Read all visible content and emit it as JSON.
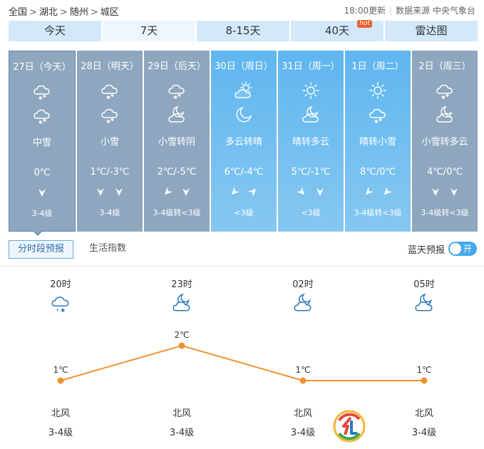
{
  "breadcrumb": [
    "全国",
    "湖北",
    "随州",
    "城区"
  ],
  "update_time": "18:00更新",
  "source_label": "数据来源 中央气象台",
  "tabs": [
    {
      "label": "今天",
      "active": false
    },
    {
      "label": "7天",
      "active": true
    },
    {
      "label": "8-15天",
      "active": false
    },
    {
      "label": "40天",
      "badge": "hot",
      "active": false
    },
    {
      "label": "雷达图",
      "active": false
    }
  ],
  "days": [
    {
      "date": "27日（今天）",
      "icon_day": "snow-cloud-icon",
      "icon_night": "snow-cloud-icon",
      "desc": "中雪",
      "temp": "0℃",
      "wind_dir": [
        "south"
      ],
      "wind_level": "3-4级",
      "style": "today"
    },
    {
      "date": "28日（明天）",
      "icon_day": "snow-cloud-icon",
      "icon_night": "snow-cloud-icon",
      "desc": "小雪",
      "temp": "1℃/-3℃",
      "wind_dir": [
        "south",
        "south"
      ],
      "wind_level": "3-4级",
      "style": "past"
    },
    {
      "date": "29日（后天）",
      "icon_day": "snow-cloud-icon",
      "icon_night": "moon-cloud-icon",
      "desc": "小雪转阴",
      "temp": "2℃/-5℃",
      "wind_dir": [
        "southwest",
        "south"
      ],
      "wind_level": "3-4级转<3级",
      "style": "past"
    },
    {
      "date": "30日（周日）",
      "icon_day": "sun-cloud-icon",
      "icon_night": "moon-icon",
      "desc": "多云转晴",
      "temp": "6℃/-4℃",
      "wind_dir": [
        "southwest",
        "northeast"
      ],
      "wind_level": "<3级",
      "style": "sunny"
    },
    {
      "date": "31日（周一）",
      "icon_day": "sun-icon",
      "icon_night": "moon-cloud-icon",
      "desc": "晴转多云",
      "temp": "5℃/-1℃",
      "wind_dir": [
        "southeast",
        "south"
      ],
      "wind_level": "<3级",
      "style": "sunny"
    },
    {
      "date": "1日（周二）",
      "icon_day": "sun-icon",
      "icon_night": "snow-cloud-icon",
      "desc": "晴转小雪",
      "temp": "8℃/0℃",
      "wind_dir": [
        "southwest",
        "southwest"
      ],
      "wind_level": "3-4级转<3级",
      "style": "sunny"
    },
    {
      "date": "2日（周三）",
      "icon_day": "snow-cloud-icon",
      "icon_night": "moon-cloud-icon",
      "desc": "小雪转多云",
      "temp": "4℃/0℃",
      "wind_dir": [
        "south",
        "south"
      ],
      "wind_level": "3-4级转<3级",
      "style": "past"
    }
  ],
  "subtabs": [
    {
      "label": "分时段预报",
      "active": true
    },
    {
      "label": "生活指数",
      "active": false
    }
  ],
  "blue_sky": {
    "label": "蓝天预报",
    "toggle": "开"
  },
  "hourly": {
    "items": [
      {
        "time": "20时",
        "icon": "snow-rain-cloud-icon",
        "temp": "1℃",
        "temp_value": 1,
        "wind_dir": "北风",
        "wind_level": "3-4级"
      },
      {
        "time": "23时",
        "icon": "moon-cloud-icon",
        "temp": "2℃",
        "temp_value": 2,
        "wind_dir": "北风",
        "wind_level": "3-4级"
      },
      {
        "time": "02时",
        "icon": "moon-cloud-icon",
        "temp": "1℃",
        "temp_value": 1,
        "wind_dir": "北风",
        "wind_level": "3-4级"
      },
      {
        "time": "05时",
        "icon": "moon-cloud-icon",
        "temp": "1℃",
        "temp_value": 1,
        "wind_dir": "北风",
        "wind_level": "3-4级"
      }
    ],
    "line_color": "#f0922e"
  },
  "colors": {
    "tab_bg": "#d3e9fb",
    "past_day": "#8ea7bf",
    "sunny_day": "#5fb6ef",
    "accent": "#45a8ea"
  }
}
